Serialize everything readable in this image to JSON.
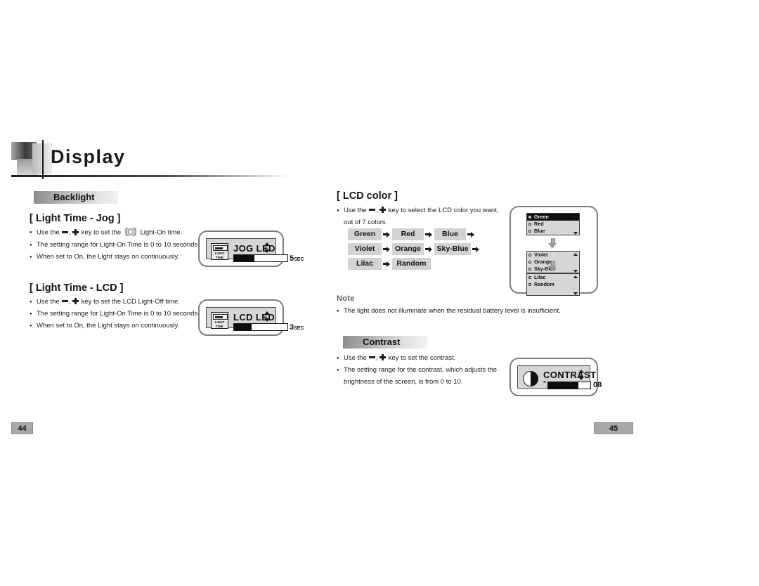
{
  "chapter": {
    "title": "Display"
  },
  "left_page": {
    "section": {
      "label": "Backlight"
    },
    "jog": {
      "heading": "[ Light Time - Jog ]",
      "bullets": [
        {
          "pre": "Use the ",
          "mid": " key to set the ",
          "icon": "jog-dial-icon",
          "post": " Light-On time."
        },
        {
          "text": "The setting range for Light-On Time is 0 to 10 seconds."
        },
        {
          "text": "When set to On, the Light stays on continuously."
        }
      ],
      "device": {
        "icon_label_line1": "LIGHT",
        "icon_label_line2": "TIME",
        "title": "JOG LED",
        "value": "5",
        "unit": "SEC",
        "fill_percent": 38
      }
    },
    "lcd": {
      "heading": "[ Light Time - LCD ]",
      "bullets": [
        {
          "pre": "Use the ",
          "mid": " key to set the LCD Light-Off time.",
          "post": ""
        },
        {
          "text": "The setting range for Light-On Time is 0 to 10 seconds."
        },
        {
          "text": "When set to On, the Light stays on continuously."
        }
      ],
      "device": {
        "icon_label_line1": "LIGHT",
        "icon_label_line2": "TIME",
        "title": "LCD LED",
        "value": "3",
        "unit": "SEC",
        "fill_percent": 33
      }
    },
    "page_number": "44"
  },
  "right_page": {
    "lcd_color": {
      "heading": "[ LCD color ]",
      "bullet_line1_pre": "Use the ",
      "bullet_line1_mid": " key to select the LCD color you want,",
      "bullet_line2": "out of 7 colors.",
      "flow": {
        "row1": [
          "Green",
          "Red",
          "Blue"
        ],
        "row2": [
          "Violet",
          "Orange",
          "Sky-Blue"
        ],
        "row3": [
          "Lilac",
          "Random"
        ]
      },
      "device_lists": [
        {
          "items": [
            "Green",
            "Red",
            "Blue"
          ],
          "selected": 0
        },
        {
          "items": [
            "Violet",
            "Orange",
            "Sky-Blue"
          ],
          "selected": -1
        },
        {
          "items": [
            "Lilac",
            "Random"
          ],
          "selected": -1
        }
      ]
    },
    "note": {
      "heading": "Note",
      "text": "The light does not illuminate when the residual battery level is insufficient."
    },
    "contrast": {
      "section_label": "Contrast",
      "bullets": [
        {
          "pre": "Use the ",
          "mid": " key to set the contrast."
        },
        {
          "text": "The setting range for the contrast, which adjusts the"
        },
        {
          "cont": "brightness of the screen, is from 0 to 10."
        }
      ],
      "device": {
        "title": "CONTRAST",
        "value": "08",
        "fill_percent": 72
      }
    },
    "page_number": "45"
  },
  "colors": {
    "ink": "#1c1c1c",
    "chip_bg": "#d2d2d2",
    "screen_bg": "#d6d6d6",
    "page_tab": "#a9a9a9"
  }
}
